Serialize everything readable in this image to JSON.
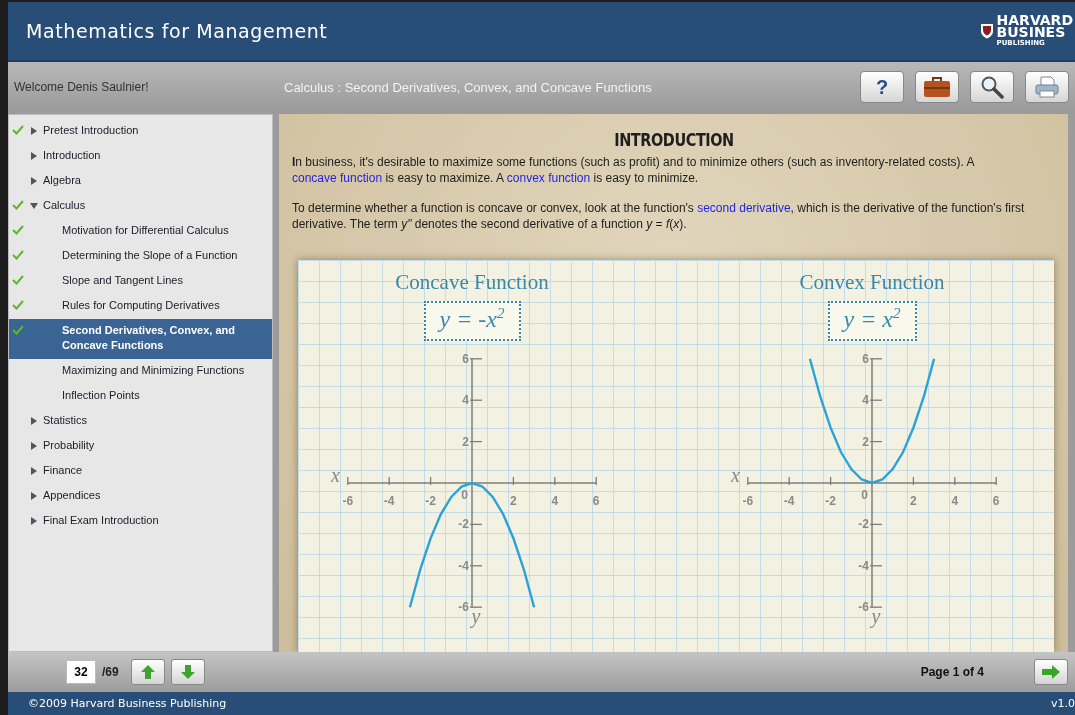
{
  "window": {
    "title": "Mathematics for Management"
  },
  "logo": {
    "lines": [
      "HARVARD",
      "BUSINES",
      "PUBLISHING"
    ]
  },
  "toolbar": {
    "welcome": "Welcome Denis Saulnier!",
    "breadcrumb": "Calculus : Second Derivatives, Convex, and Concave Functions",
    "buttons": [
      {
        "kind": "help",
        "label": "?"
      },
      {
        "kind": "briefcase"
      },
      {
        "kind": "search"
      },
      {
        "kind": "print"
      }
    ]
  },
  "sidebar": {
    "items": [
      {
        "label": "Pretest Introduction",
        "checked": true,
        "expanded": false,
        "selected": false
      },
      {
        "label": "Introduction",
        "checked": false,
        "expanded": false,
        "selected": false
      },
      {
        "label": "Algebra",
        "checked": false,
        "expanded": false,
        "selected": false
      },
      {
        "label": "Calculus",
        "checked": true,
        "expanded": true,
        "selected": false,
        "children": [
          {
            "label": "Motivation for Differential Calculus",
            "checked": true,
            "selected": false
          },
          {
            "label": "Determining the Slope of a Function",
            "checked": true,
            "selected": false
          },
          {
            "label": "Slope and Tangent Lines",
            "checked": true,
            "selected": false
          },
          {
            "label": "Rules for Computing Derivatives",
            "checked": true,
            "selected": false
          },
          {
            "label": "Second Derivatives, Convex, and Concave Functions",
            "checked": true,
            "selected": true
          },
          {
            "label": "Maximizing and Minimizing Functions",
            "checked": false,
            "selected": false
          },
          {
            "label": "Inflection Points",
            "checked": false,
            "selected": false
          }
        ]
      },
      {
        "label": "Statistics",
        "checked": false,
        "expanded": false,
        "selected": false
      },
      {
        "label": "Probability",
        "checked": false,
        "expanded": false,
        "selected": false
      },
      {
        "label": "Finance",
        "checked": false,
        "expanded": false,
        "selected": false
      },
      {
        "label": "Appendices",
        "checked": false,
        "expanded": false,
        "selected": false
      },
      {
        "label": "Final Exam Introduction",
        "checked": false,
        "expanded": false,
        "selected": false
      }
    ]
  },
  "content": {
    "heading": "INTRODUCTION",
    "paragraphs": [
      [
        {
          "kind": "text",
          "text": "**I**n business, it's desirable to maximize some functions (such as profit) and to minimize others (such as inventory-related costs). A "
        },
        {
          "kind": "link",
          "text": "concave function"
        },
        {
          "kind": "text",
          "text": " is easy to maximize. A "
        },
        {
          "kind": "link",
          "text": "convex function"
        },
        {
          "kind": "text",
          "text": " is easy to minimize."
        }
      ],
      [
        {
          "kind": "text",
          "text": "To determine whether a function is concave or convex, look at the function's "
        },
        {
          "kind": "link",
          "text": "second derivative"
        },
        {
          "kind": "text",
          "text": ", which is the derivative of the function's first derivative. The term *y\"* denotes the second derivative of a function *y* = *f*(*x*)."
        }
      ]
    ],
    "charts": [
      {
        "equation": "y = -x$^{2}$",
        "axis_labels": {
          "x": "x",
          "y": "y",
          "origin": "0"
        },
        "chart_data": {
          "type": "line",
          "title": "Concave Function",
          "x": [
            -3,
            -2.5,
            -2,
            -1.5,
            -1,
            -0.5,
            0,
            0.5,
            1,
            1.5,
            2,
            2.5,
            3
          ],
          "series": [
            {
              "color": "#2aa3d8",
              "values": [
                -6,
                -4.17,
                -2.67,
                -1.5,
                -0.67,
                -0.17,
                0,
                -0.17,
                -0.67,
                -1.5,
                -2.67,
                -4.17,
                -6
              ]
            }
          ],
          "xlim": [
            -6,
            6
          ],
          "ylim": [
            -6,
            6
          ],
          "xticks": [
            -6,
            -4,
            -2,
            2,
            4,
            6
          ],
          "yticks": [
            -6,
            -4,
            -2,
            2,
            4,
            6
          ]
        }
      },
      {
        "equation": "y = x$^{2}$",
        "axis_labels": {
          "x": "x",
          "y": "y",
          "origin": "0"
        },
        "chart_data": {
          "type": "line",
          "title": "Convex Function",
          "x": [
            -3,
            -2.5,
            -2,
            -1.5,
            -1,
            -0.5,
            0,
            0.5,
            1,
            1.5,
            2,
            2.5,
            3
          ],
          "series": [
            {
              "color": "#2aa3d8",
              "values": [
                6,
                4.17,
                2.67,
                1.5,
                0.67,
                0.17,
                0,
                0.17,
                0.67,
                1.5,
                2.67,
                4.17,
                6
              ]
            }
          ],
          "xlim": [
            -6,
            6
          ],
          "ylim": [
            -6,
            6
          ],
          "xticks": [
            -6,
            -4,
            -2,
            2,
            4,
            6
          ],
          "yticks": [
            -6,
            -4,
            -2,
            2,
            4,
            6
          ]
        }
      }
    ]
  },
  "pager": {
    "current": "32",
    "total": "/69",
    "page_label": "Page 1 of 4"
  },
  "status_bar": {
    "copyright": "©2009 Harvard Business Publishing",
    "version": "v1.0"
  }
}
